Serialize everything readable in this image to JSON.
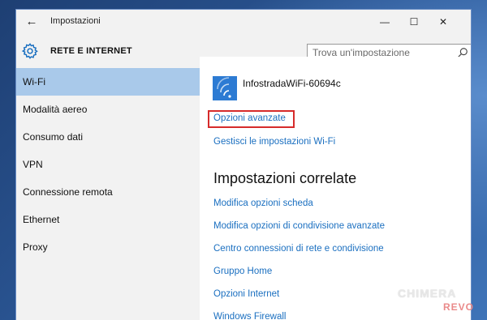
{
  "window": {
    "title": "Impostazioni",
    "back_glyph": "←",
    "minimize_glyph": "—",
    "maximize_glyph": "☐",
    "close_glyph": "✕"
  },
  "header": {
    "section_title": "RETE E INTERNET",
    "section_icon": "gear-icon"
  },
  "search": {
    "placeholder": "Trova un'impostazione",
    "icon": "search-icon"
  },
  "sidebar": {
    "items": [
      {
        "label": "Wi-Fi",
        "selected": true
      },
      {
        "label": "Modalità aereo",
        "selected": false
      },
      {
        "label": "Consumo dati",
        "selected": false
      },
      {
        "label": "VPN",
        "selected": false
      },
      {
        "label": "Connessione remota",
        "selected": false
      },
      {
        "label": "Ethernet",
        "selected": false
      },
      {
        "label": "Proxy",
        "selected": false
      }
    ]
  },
  "main": {
    "network": {
      "ssid": "InfostradaWiFi-60694c",
      "icon": "wifi-icon"
    },
    "advanced_options_link": "Opzioni avanzate",
    "manage_wifi_link": "Gestisci le impostazioni Wi-Fi",
    "related_title": "Impostazioni correlate",
    "related_links": [
      "Modifica opzioni scheda",
      "Modifica opzioni di condivisione avanzate",
      "Centro connessioni di rete e condivisione",
      "Gruppo Home",
      "Opzioni Internet",
      "Windows Firewall"
    ]
  },
  "watermark": {
    "line1": "CHIMERA",
    "line2": "REVO"
  },
  "colors": {
    "accent": "#2d7bd3",
    "link": "#1a6fc0",
    "selected_bg": "#a9c9ea",
    "highlight_border": "#d62b2b"
  }
}
